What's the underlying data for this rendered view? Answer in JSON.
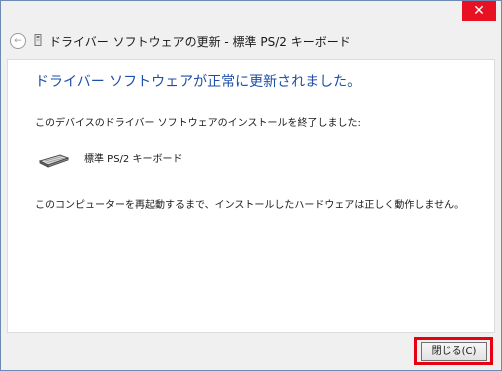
{
  "window": {
    "close_glyph": "✕"
  },
  "header": {
    "back_glyph": "←",
    "title": "ドライバー ソフトウェアの更新 - 標準 PS/2 キーボード"
  },
  "content": {
    "heading": "ドライバー ソフトウェアが正常に更新されました。",
    "finished_message": "このデバイスのドライバー ソフトウェアのインストールを終了しました:",
    "device_name": "標準 PS/2 キーボード",
    "device_icon": "keyboard-icon",
    "restart_message": "このコンピューターを再起動するまで、インストールしたハードウェアは正しく動作しません。"
  },
  "footer": {
    "close_label": "閉じる(C)"
  },
  "colors": {
    "heading_blue": "#1e4fa8",
    "close_red": "#e81123",
    "highlight_red": "#e60012"
  }
}
